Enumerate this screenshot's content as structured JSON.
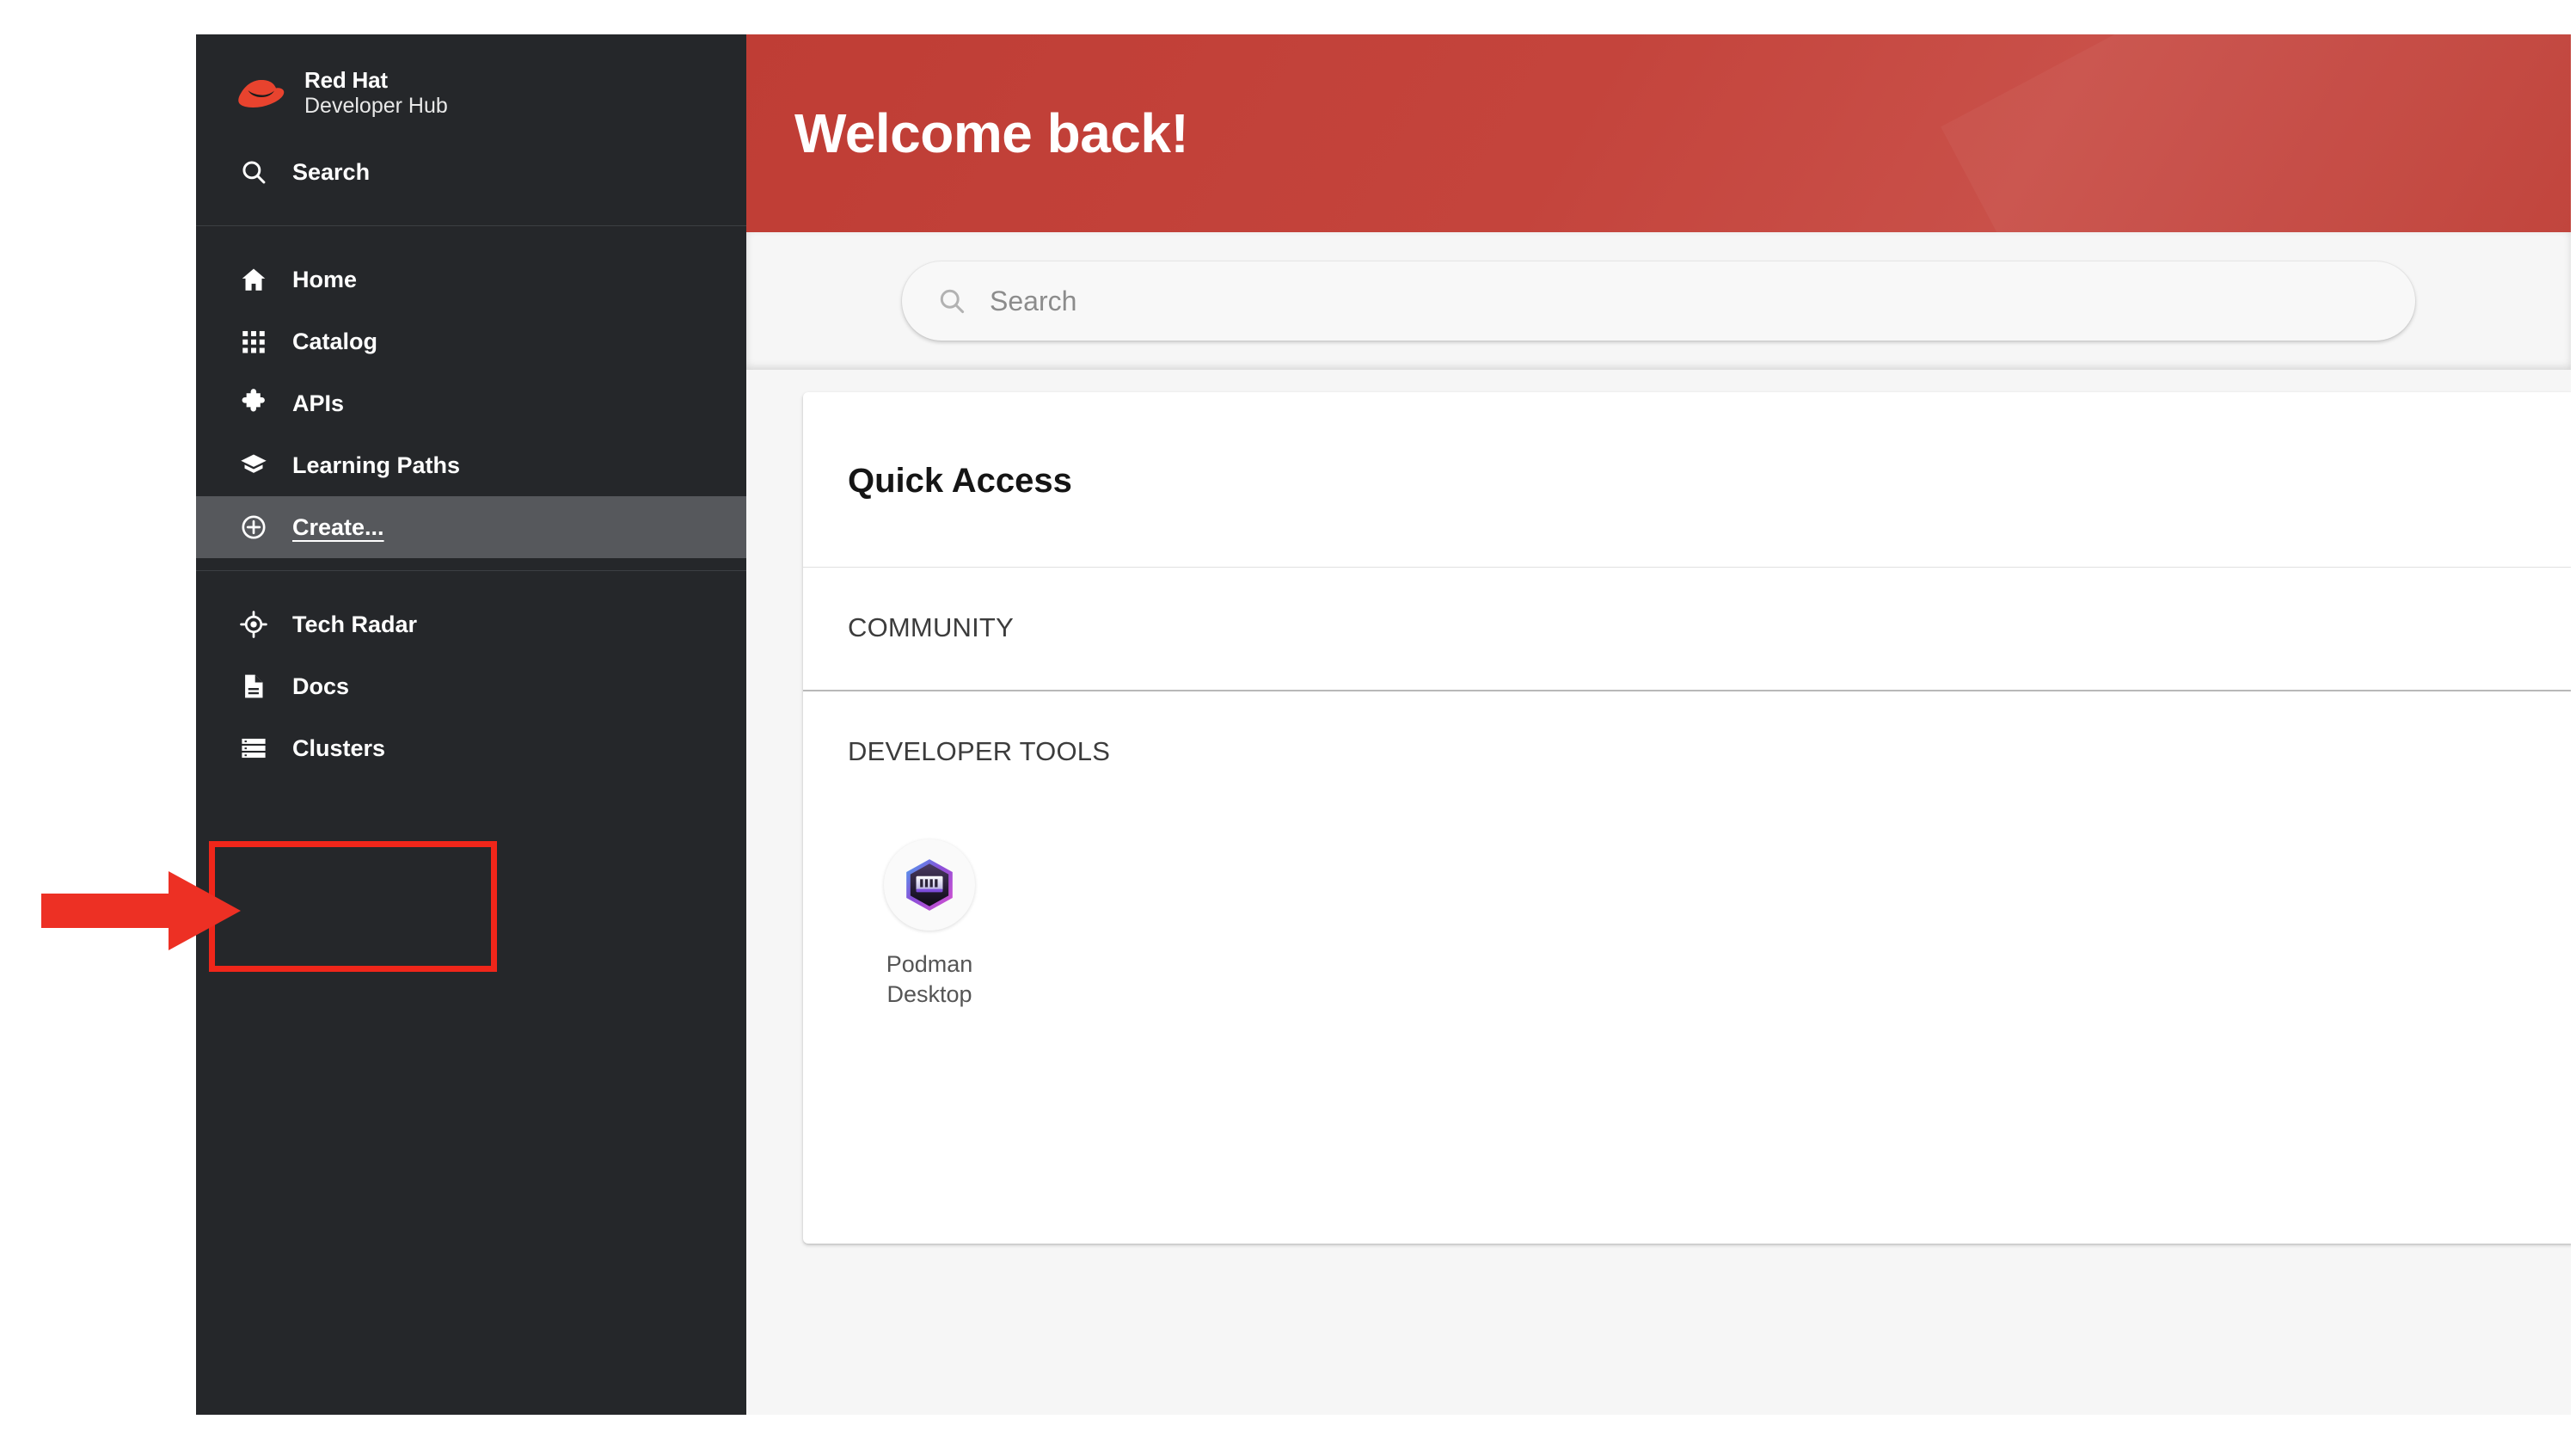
{
  "app": {
    "brand_title": "Red Hat",
    "brand_subtitle": "Developer Hub",
    "brand_logo_icon": "red-hat-fedora-logo"
  },
  "sidebar": {
    "search": {
      "label": "Search",
      "icon": "search-icon"
    },
    "groups": [
      {
        "items": [
          {
            "label": "Home",
            "icon": "home-icon",
            "selected": false
          },
          {
            "label": "Catalog",
            "icon": "grid-apps-icon",
            "selected": false
          },
          {
            "label": "APIs",
            "icon": "puzzle-piece-icon",
            "selected": false
          },
          {
            "label": "Learning Paths",
            "icon": "graduation-cap-icon",
            "selected": false
          },
          {
            "label": "Create...",
            "icon": "plus-circle-icon",
            "selected": true
          }
        ]
      },
      {
        "items": [
          {
            "label": "Tech Radar",
            "icon": "radar-target-icon",
            "selected": false
          },
          {
            "label": "Docs",
            "icon": "document-icon",
            "selected": false
          },
          {
            "label": "Clusters",
            "icon": "server-stack-icon",
            "selected": false
          }
        ]
      }
    ]
  },
  "header": {
    "title": "Welcome back!",
    "banner_color": "#bf3d35"
  },
  "search": {
    "placeholder": "Search",
    "icon": "search-icon",
    "value": ""
  },
  "quick_access": {
    "title": "Quick Access",
    "sections": [
      {
        "label": "COMMUNITY",
        "items": []
      },
      {
        "label": "DEVELOPER TOOLS",
        "items": [
          {
            "label": "Podman\nDesktop",
            "label_line1": "Podman",
            "label_line2": "Desktop",
            "icon": "podman-desktop-icon"
          }
        ]
      }
    ]
  },
  "annotations": {
    "highlight_color": "#f0261a",
    "arrow_icon": "right-arrow-annotation",
    "box_target": "Create..."
  }
}
